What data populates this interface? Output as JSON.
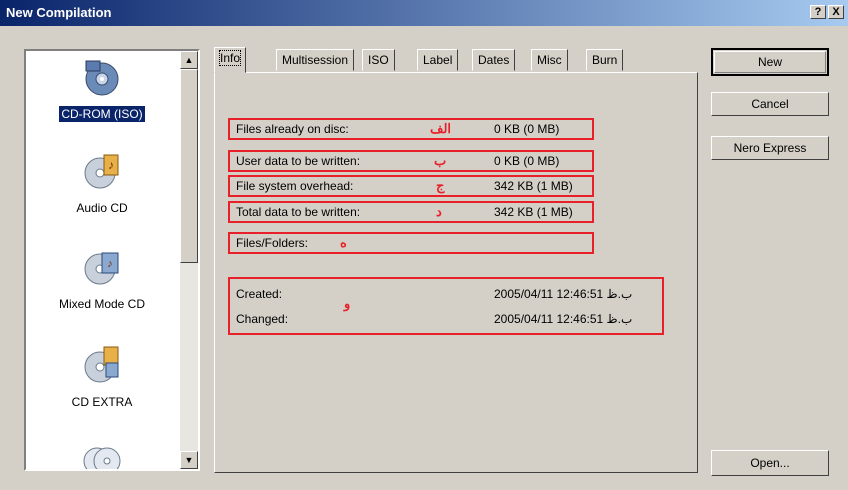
{
  "window": {
    "title": "New Compilation",
    "help_label": "?",
    "close_label": "X"
  },
  "compilation_types": [
    {
      "label": "CD-ROM (ISO)",
      "icon": "cd-rom-iso-icon",
      "selected": true
    },
    {
      "label": "Audio CD",
      "icon": "audio-cd-icon"
    },
    {
      "label": "Mixed Mode CD",
      "icon": "mixed-mode-cd-icon"
    },
    {
      "label": "CD EXTRA",
      "icon": "cd-extra-icon"
    },
    {
      "label": "",
      "icon": "copy-cd-icon"
    }
  ],
  "scrollbar": {
    "up": "▲",
    "down": "▼"
  },
  "tabs": [
    "Info",
    "Multisession",
    "ISO",
    "Label",
    "Dates",
    "Misc",
    "Burn"
  ],
  "info": {
    "files_on_disc": {
      "label": "Files already on disc:",
      "annotation": "الف",
      "value": "0 KB (0 MB)"
    },
    "user_data": {
      "label": "User data to be written:",
      "annotation": "ب",
      "value": "0 KB (0 MB)"
    },
    "fs_overhead": {
      "label": "File system overhead:",
      "annotation": "ج",
      "value": "342 KB (1 MB)"
    },
    "total_data": {
      "label": "Total data to be written:",
      "annotation": "د",
      "value": "342 KB (1 MB)"
    },
    "files_folders": {
      "label": "Files/Folders:",
      "annotation": "ه"
    },
    "dates_annotation": "و",
    "created": {
      "label": "Created:",
      "value": "2005/04/11 12:46:51 ب.ظ"
    },
    "changed": {
      "label": "Changed:",
      "value": "2005/04/11 12:46:51 ب.ظ"
    }
  },
  "buttons": {
    "new": "New",
    "cancel": "Cancel",
    "nero_express": "Nero Express",
    "open": "Open..."
  }
}
